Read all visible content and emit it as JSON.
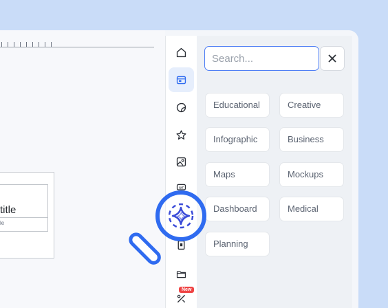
{
  "canvas": {
    "slide_title": "title",
    "slide_subtitle": "le"
  },
  "sidebar": {
    "items": [
      {
        "name": "home",
        "icon": "home-icon"
      },
      {
        "name": "templates",
        "icon": "template-icon",
        "active": true
      },
      {
        "name": "stickers",
        "icon": "sticker-icon"
      },
      {
        "name": "favorites",
        "icon": "star-icon"
      },
      {
        "name": "photos",
        "icon": "image-icon"
      },
      {
        "name": "gif",
        "icon": "gif-icon",
        "label": "GIF"
      },
      {
        "name": "ai",
        "icon": "sparkle-icon"
      },
      {
        "name": "book",
        "icon": "book-icon"
      },
      {
        "name": "folder",
        "icon": "folder-icon"
      },
      {
        "name": "tools",
        "icon": "tools-icon"
      }
    ],
    "new_badge": "New"
  },
  "panel": {
    "search": {
      "placeholder": "Search...",
      "value": ""
    },
    "categories": [
      "Educational",
      "Creative",
      "Infographic",
      "Business",
      "Maps",
      "Mockups",
      "Dashboard",
      "Medical",
      "Planning"
    ]
  },
  "colors": {
    "accent": "#2f6bf0",
    "search_border": "#4f7ff5",
    "background": "#c9dcf8",
    "badge": "#ef4444"
  }
}
